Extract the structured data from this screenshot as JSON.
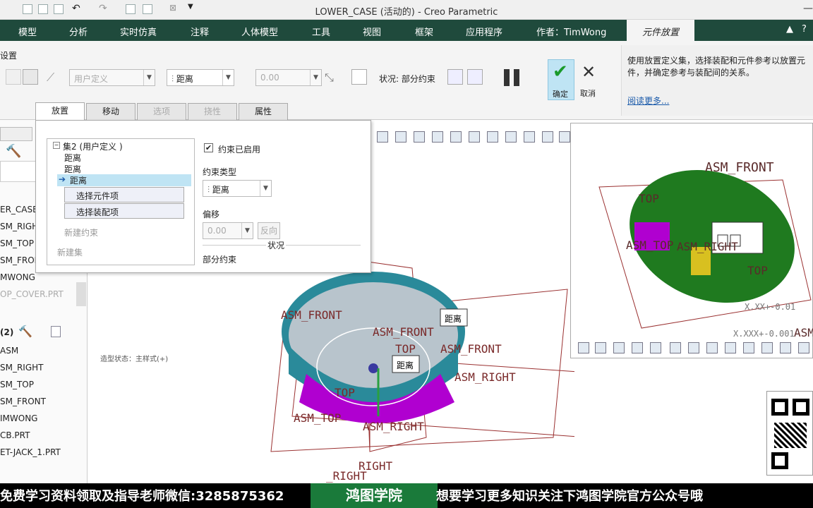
{
  "window": {
    "title": "LOWER_CASE (活动的) - Creo Parametric",
    "menu_caret": "▼",
    "minimize": "—",
    "restore": "❐"
  },
  "ribbon_tabs": [
    "模型",
    "分析",
    "实时仿真",
    "注释",
    "人体模型",
    "工具",
    "视图",
    "框架",
    "应用程序",
    "作者：TimWong",
    "元件放置"
  ],
  "ribbon_controls": [
    "▲",
    "?"
  ],
  "ribbon": {
    "group_label": "设置",
    "constraint_set_type": "用户定义",
    "constraint_type": "距离",
    "offset_value": "0.00",
    "status_text": "状况: 部分约束",
    "ok_label": "确定",
    "cancel_label": "取消"
  },
  "help": {
    "text": "使用放置定义集，选择装配和元件参考以放置元件，并确定参考与装配间的关系。",
    "link": "阅读更多..."
  },
  "dialog_tabs": [
    {
      "label": "放置",
      "state": "active"
    },
    {
      "label": "移动",
      "state": "normal"
    },
    {
      "label": "选项",
      "state": "disabled"
    },
    {
      "label": "挠性",
      "state": "disabled"
    },
    {
      "label": "属性",
      "state": "normal"
    }
  ],
  "placement": {
    "set_label": "集2 (用户定义 )",
    "items": [
      "距离",
      "距离",
      "距离"
    ],
    "select_component": "选择元件项",
    "select_assembly": "选择装配项",
    "new_constraint": "新建约束",
    "new_set": "新建集",
    "enabled_label": "约束已启用",
    "constraint_type_label": "约束类型",
    "constraint_type_value": "距离",
    "offset_label": "偏移",
    "offset_value": "0.00",
    "flip_label": "反向",
    "status_heading": "状况",
    "status_value": "部分约束"
  },
  "left_tree": {
    "top_items": [
      "ER_CASE.",
      "SM_RIGHT",
      "SM_TOP",
      "SM_FRON",
      "MWONG",
      "OP_COVER.PRT"
    ],
    "section_label": "(2)",
    "bottom_items": [
      "ASM",
      "SM_RIGHT",
      "SM_TOP",
      "SM_FRONT",
      "IMWONG",
      "CB.PRT",
      "ET-JACK_1.PRT"
    ]
  },
  "canvas": {
    "status_note": "造型状态：主样式(+)",
    "labels": [
      "ASM_FRONT",
      "ASM_FRONT",
      "TOP",
      "ASM_FRONT",
      "TOP",
      "ASM_RIGHT",
      "ASM_TOP",
      "ASM_RIGHT",
      "RIGHT",
      "_RIGHT"
    ],
    "callouts": [
      "距离",
      "距离"
    ]
  },
  "preview": {
    "labels": [
      "ASM_FRONT",
      "TOP",
      "ASM_TOP",
      "ASM_RIGHT",
      "TOP",
      "X.XX+-0.01",
      "X.XXX+-0.001",
      "ASM"
    ]
  },
  "banner": {
    "left": "免费学习资料领取及指导老师微信:3285875362",
    "center": "鸿图学院",
    "right": "想要学习更多知识关注下鸿图学院官方公众号哦"
  },
  "colors": {
    "ribbon_tab_bg": "#1f4a3c",
    "selection": "#bfe4f4",
    "pcb_green": "#1f7a1f",
    "part_purple": "#b000d0",
    "case_teal": "#2a8a9a"
  }
}
